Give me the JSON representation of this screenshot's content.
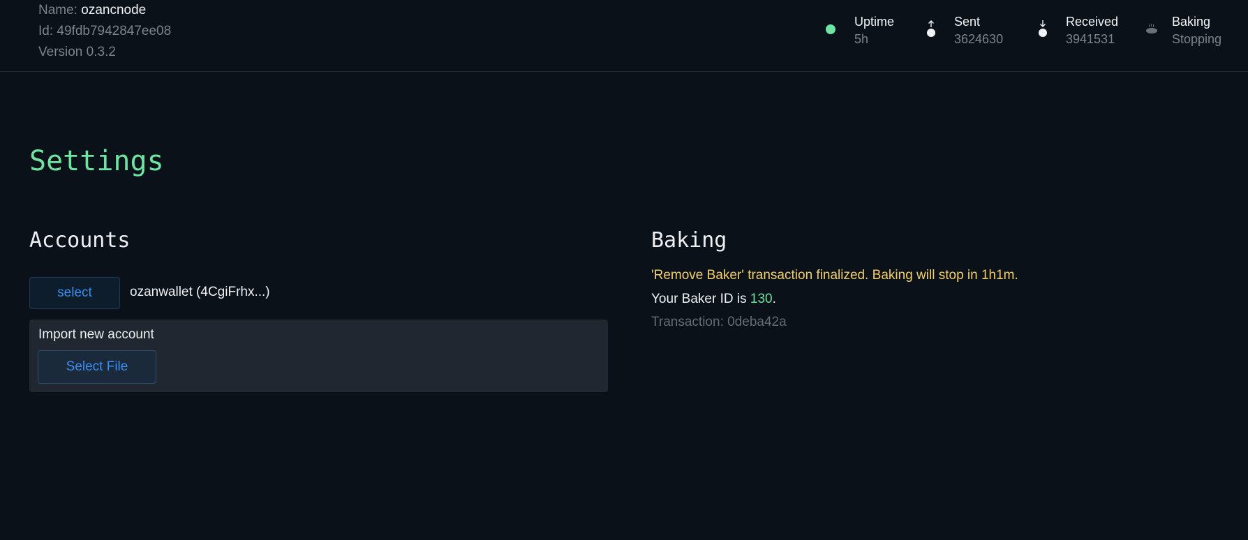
{
  "node": {
    "name_label": "Name:",
    "name_value": "ozancnode",
    "id_label": "Id:",
    "id_value": "49fdb7942847ee08",
    "version_text": "Version 0.3.2"
  },
  "stats": {
    "uptime": {
      "label": "Uptime",
      "value": "5h",
      "icon": "status-dot-icon",
      "color": "#6fe3a2"
    },
    "sent": {
      "label": "Sent",
      "value": "3624630",
      "icon": "arrow-up-icon"
    },
    "received": {
      "label": "Received",
      "value": "3941531",
      "icon": "arrow-down-icon"
    },
    "baking": {
      "label": "Baking",
      "value": "Stopping",
      "icon": "bread-icon"
    }
  },
  "page": {
    "title": "Settings"
  },
  "accounts": {
    "title": "Accounts",
    "select_button": "select",
    "wallet": "ozanwallet (4CgiFrhx...)",
    "import_label": "Import new account",
    "select_file_button": "Select File"
  },
  "baking": {
    "title": "Baking",
    "status_message": "'Remove Baker' transaction finalized. Baking will stop in 1h1m.",
    "baker_id_prefix": "Your Baker ID is ",
    "baker_id": "130",
    "baker_id_suffix": ".",
    "transaction_text": "Transaction: 0deba42a"
  },
  "colors": {
    "accent_green": "#6fe3a2",
    "warning_yellow": "#f2cf6d",
    "link_blue": "#3b8df0",
    "background": "#0b1118"
  }
}
